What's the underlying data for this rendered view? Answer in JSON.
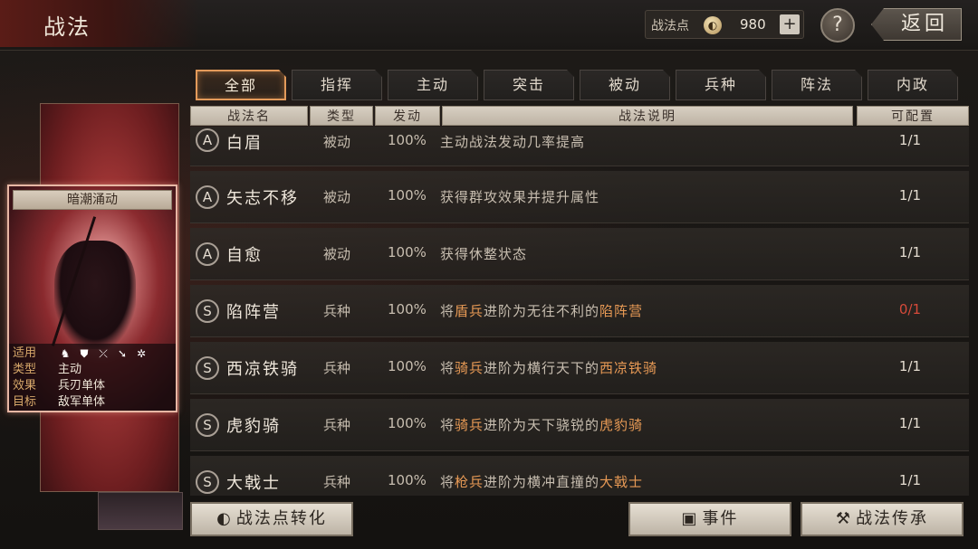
{
  "header": {
    "title": "战法",
    "points_label": "战法点",
    "points_value": "980",
    "plus_label": "+",
    "help_label": "?",
    "back_label": "返回"
  },
  "card": {
    "title": "暗潮涌动",
    "info": [
      {
        "key": "适用",
        "value": ""
      },
      {
        "key": "类型",
        "value": "主动"
      },
      {
        "key": "效果",
        "value": "兵刃单体"
      },
      {
        "key": "目标",
        "value": "敌军单体"
      }
    ],
    "unit_icons": [
      "cavalry-icon",
      "shield-icon",
      "bow-icon",
      "spear-icon",
      "wheel-icon"
    ]
  },
  "tabs": [
    {
      "label": "全部",
      "active": true
    },
    {
      "label": "指挥",
      "active": false
    },
    {
      "label": "主动",
      "active": false
    },
    {
      "label": "突击",
      "active": false
    },
    {
      "label": "被动",
      "active": false
    },
    {
      "label": "兵种",
      "active": false
    },
    {
      "label": "阵法",
      "active": false
    },
    {
      "label": "内政",
      "active": false
    }
  ],
  "table": {
    "headers": {
      "name": "战法名",
      "type": "类型",
      "rate": "发动",
      "desc": "战法说明",
      "config": "可配置"
    },
    "rows": [
      {
        "grade": "A",
        "name": "白眉",
        "type": "被动",
        "rate": "100%",
        "desc": [
          {
            "t": "主动战法发动几率提高"
          }
        ],
        "config": "1/1",
        "config_red": false
      },
      {
        "grade": "A",
        "name": "矢志不移",
        "type": "被动",
        "rate": "100%",
        "desc": [
          {
            "t": "获得群攻效果并提升属性"
          }
        ],
        "config": "1/1",
        "config_red": false
      },
      {
        "grade": "A",
        "name": "自愈",
        "type": "被动",
        "rate": "100%",
        "desc": [
          {
            "t": "获得休整状态"
          }
        ],
        "config": "1/1",
        "config_red": false
      },
      {
        "grade": "S",
        "name": "陷阵营",
        "type": "兵种",
        "rate": "100%",
        "desc": [
          {
            "t": "将"
          },
          {
            "t": "盾兵",
            "hl": true
          },
          {
            "t": "进阶为无往不利的"
          },
          {
            "t": "陷阵营",
            "hl": true
          }
        ],
        "config": "0/1",
        "config_red": true
      },
      {
        "grade": "S",
        "name": "西凉铁骑",
        "type": "兵种",
        "rate": "100%",
        "desc": [
          {
            "t": "将"
          },
          {
            "t": "骑兵",
            "hl": true
          },
          {
            "t": "进阶为横行天下的"
          },
          {
            "t": "西凉铁骑",
            "hl": true
          }
        ],
        "config": "1/1",
        "config_red": false
      },
      {
        "grade": "S",
        "name": "虎豹骑",
        "type": "兵种",
        "rate": "100%",
        "desc": [
          {
            "t": "将"
          },
          {
            "t": "骑兵",
            "hl": true
          },
          {
            "t": "进阶为天下骁锐的"
          },
          {
            "t": "虎豹骑",
            "hl": true
          }
        ],
        "config": "1/1",
        "config_red": false
      },
      {
        "grade": "S",
        "name": "大戟士",
        "type": "兵种",
        "rate": "100%",
        "desc": [
          {
            "t": "将"
          },
          {
            "t": "枪兵",
            "hl": true
          },
          {
            "t": "进阶为横冲直撞的"
          },
          {
            "t": "大戟士",
            "hl": true
          }
        ],
        "config": "1/1",
        "config_red": false
      }
    ]
  },
  "footer": {
    "convert_label": "战法点转化",
    "events_label": "事件",
    "inherit_label": "战法传承"
  },
  "colors": {
    "highlight": "#e89a55",
    "warning": "#d64a3a",
    "tab_active_border": "#e39a5a"
  }
}
